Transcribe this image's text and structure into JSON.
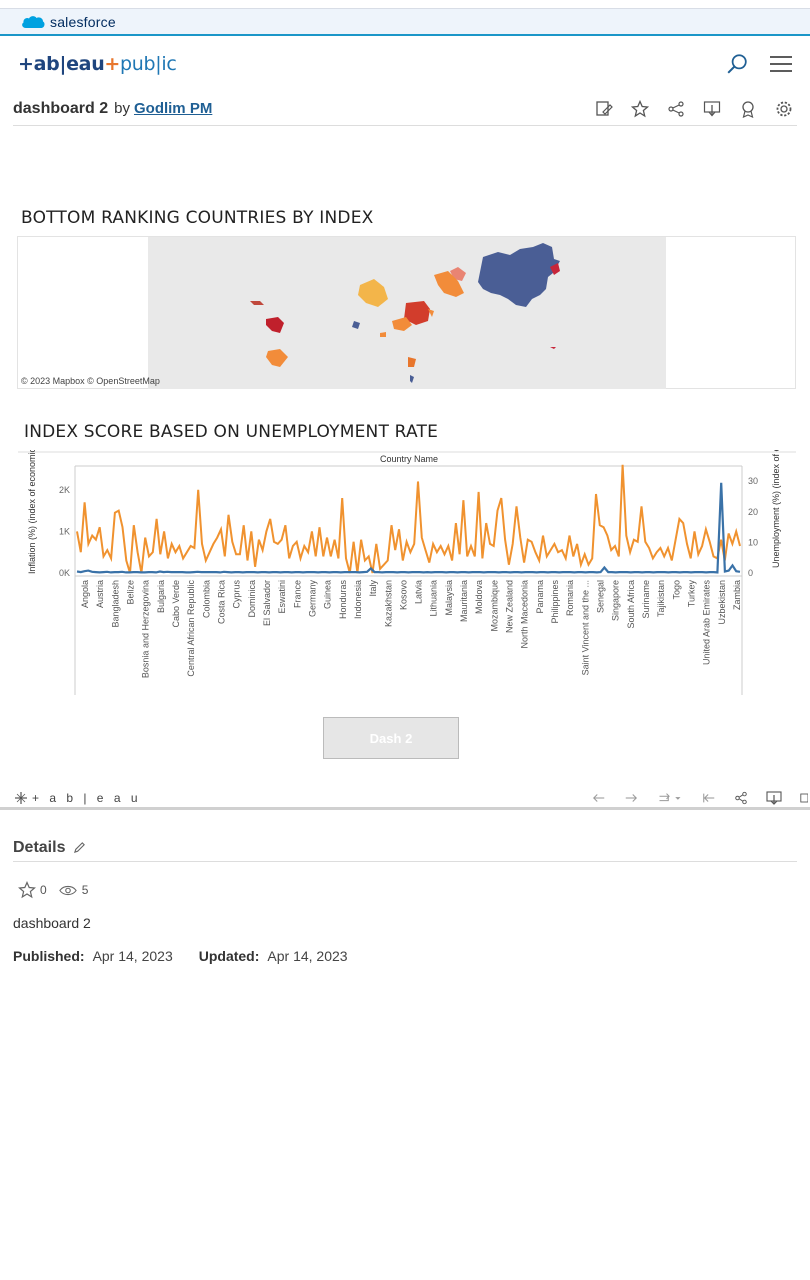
{
  "salesforce": {
    "label": "salesforce"
  },
  "header": {
    "logo_main": "+ab|eau",
    "logo_sep": "+",
    "logo_pub": "pub|ic"
  },
  "viz": {
    "title": "dashboard 2",
    "by": "by",
    "author": "Godlim PM"
  },
  "map": {
    "title": "BOTTOM RANKING COUNTRIES BY INDEX",
    "credit": "© 2023 Mapbox © OpenStreetMap"
  },
  "line_chart_title": "INDEX SCORE BASED ON UNEMPLOYMENT RATE",
  "chart_data": {
    "type": "line",
    "title": "INDEX SCORE BASED ON UNEMPLOYMENT RATE",
    "xlabel": "Country Name",
    "ylabel_left": "Inflation (%) (index of economic...",
    "ylabel_right": "Unemployment (%) (index of economic...",
    "y_left_ticks": [
      "0K",
      "1K",
      "2K"
    ],
    "y_left_range": [
      0,
      2500
    ],
    "y_right_ticks": [
      "0",
      "10",
      "20",
      "30"
    ],
    "y_right_range": [
      0,
      34
    ],
    "categories": [
      "Angola",
      "Austria",
      "Bangladesh",
      "Belize",
      "Bosnia and Herzegovina",
      "Bulgaria",
      "Cabo Verde",
      "Central African Republic",
      "Colombia",
      "Costa Rica",
      "Cyprus",
      "Dominica",
      "El Salvador",
      "Eswatini",
      "France",
      "Germany",
      "Guinea",
      "Honduras",
      "Indonesia",
      "Italy",
      "Kazakhstan",
      "Kosovo",
      "Latvia",
      "Lithuania",
      "Malaysia",
      "Mauritania",
      "Moldova",
      "Mozambique",
      "New Zealand",
      "North Macedonia",
      "Panama",
      "Philippines",
      "Romania",
      "Saint Vincent and the ...",
      "Senegal",
      "Singapore",
      "South Africa",
      "Suriname",
      "Tajikistan",
      "Togo",
      "Turkey",
      "United Arab Emirates",
      "Uzbekistan",
      "Zambia"
    ],
    "series": [
      {
        "name": "Inflation (%)",
        "color": "#f0922f",
        "values": [
          1000,
          500,
          1700,
          700,
          900,
          800,
          1100,
          400,
          550,
          350,
          1450,
          1500,
          1100,
          300,
          0,
          1150,
          500,
          0,
          850,
          400,
          500,
          1300,
          450,
          1000,
          350,
          700,
          500,
          650,
          350,
          500,
          650,
          600,
          2000,
          700,
          300,
          500,
          700,
          850,
          1050,
          400,
          1400,
          750,
          450,
          450,
          1150,
          300,
          1000,
          150,
          800,
          550,
          1000,
          1300,
          750,
          700,
          800,
          1150,
          350,
          650,
          750,
          350,
          650,
          500,
          1000,
          400,
          1100,
          400,
          850,
          400,
          800,
          350,
          1800,
          350,
          0,
          750,
          0,
          800,
          300,
          400,
          0,
          700,
          100,
          200,
          300,
          1150,
          550,
          1050,
          300,
          750,
          500,
          700,
          2200,
          850,
          550,
          250,
          700,
          500,
          650,
          450,
          650,
          300,
          1200,
          450,
          1750,
          400,
          650,
          400,
          1950,
          350,
          1200,
          700,
          650,
          1500,
          1800,
          800,
          200,
          700,
          1600,
          850,
          250,
          800,
          750,
          500,
          300,
          900,
          400,
          550,
          700,
          500,
          550,
          350,
          900,
          400,
          700,
          200,
          450,
          200,
          350,
          1900,
          1150,
          1100,
          900,
          550,
          650,
          400,
          2600,
          900,
          500,
          800,
          750,
          1600,
          750,
          600,
          350,
          500,
          600,
          400,
          600,
          300,
          800,
          1300,
          1200,
          700,
          350,
          1000,
          450,
          650,
          1050,
          750,
          400,
          350,
          800,
          300,
          950,
          700,
          1000,
          650
        ]
      },
      {
        "name": "Unemployment (%)",
        "color": "#3a72a8",
        "values": [
          0.5,
          0.3,
          0.6,
          0.8,
          0.4,
          0.3,
          0.2,
          0.3,
          0.4,
          0.2,
          0.3,
          0.3,
          0.4,
          0.2,
          0.2,
          0.3,
          0.3,
          0.2,
          0.2,
          0.3,
          0.3,
          0.2,
          0.5,
          0.3,
          0.4,
          0.3,
          0.3,
          0.3,
          0.3,
          0.2,
          0.2,
          0.3,
          0.4,
          0.3,
          0.3,
          0.3,
          0.3,
          0.3,
          0.2,
          0.4,
          0.3,
          0.2,
          0.3,
          0.3,
          0.2,
          0.3,
          0.3,
          0.3,
          0.2,
          0.3,
          0.3,
          0.2,
          0.3,
          0.3,
          0.2,
          0.3,
          0.3,
          0.2,
          0.3,
          0.3,
          0.2,
          0.3,
          0.3,
          0.3,
          0.2,
          0.3,
          0.3,
          0.2,
          0.3,
          0.3,
          0.2,
          0.3,
          0.3,
          0.3,
          0.3,
          0.2,
          0.3,
          0.4,
          1.5,
          0.3,
          0.3,
          0.2,
          0.3,
          0.3,
          0.3,
          0.2,
          0.3,
          0.3,
          0.2,
          0.3,
          0.3,
          0.3,
          0.2,
          0.3,
          0.2,
          0.3,
          0.3,
          0.3,
          0.2,
          0.3,
          0.3,
          0.2,
          0.3,
          0.3,
          0.2,
          0.3,
          0.3,
          0.3,
          0.2,
          0.3,
          0.3,
          0.3,
          0.2,
          0.3,
          0.3,
          0.2,
          0.3,
          0.3,
          0.2,
          0.3,
          0.3,
          0.3,
          0.2,
          0.3,
          0.3,
          0.2,
          0.3,
          0.3,
          0.2,
          0.3,
          0.3,
          0.3,
          0.2,
          0.3,
          0.3,
          0.2,
          0.3,
          0.3,
          0.2,
          0.3,
          1.8,
          0.3,
          0.3,
          0.2,
          0.3,
          0.3,
          0.3,
          0.2,
          0.3,
          0.3,
          0.2,
          0.3,
          0.3,
          0.2,
          0.3,
          0.3,
          0.3,
          0.2,
          0.3,
          0.3,
          0.2,
          0.3,
          0.3,
          0.2,
          0.3,
          0.3,
          0.3,
          0.2,
          0.3,
          0.3,
          0.2,
          29.5,
          0.5,
          0.8,
          2.5,
          0.6,
          0.4
        ]
      }
    ]
  },
  "dash_button": "Dash 2",
  "toolbar": {
    "brand": "+ a b | e a u"
  },
  "details": {
    "heading": "Details",
    "stars": "0",
    "views": "5",
    "description": "dashboard 2",
    "published_label": "Published:",
    "published_date": "Apr 14, 2023",
    "updated_label": "Updated:",
    "updated_date": "Apr 14, 2023"
  }
}
